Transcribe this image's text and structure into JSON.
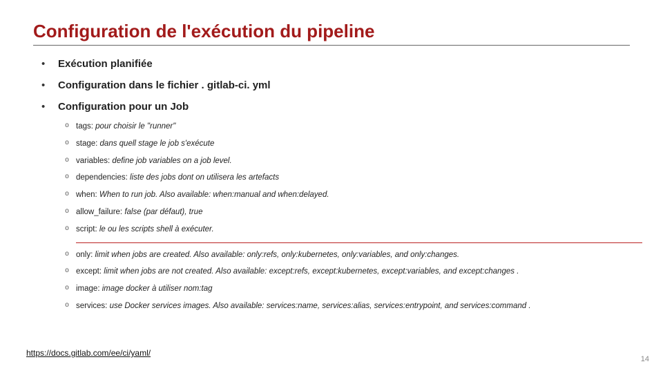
{
  "title": "Configuration de l'exécution du pipeline",
  "main_items": {
    "i0": "Exécution planifiée",
    "i1_prefix": "Configuration dans le fichier",
    "i1_file": ". gitlab-ci. yml",
    "i2": "Configuration pour un Job"
  },
  "group1": {
    "s0": {
      "key": "tags: ",
      "desc": "pour choisir le \"runner\""
    },
    "s1": {
      "key": "stage: ",
      "desc": "dans quell stage le job s'exécute"
    },
    "s2": {
      "key": "variables: ",
      "desc": "define job variables on a job level."
    },
    "s3": {
      "key": "dependencies: ",
      "desc": "liste des jobs dont on utilisera les artefacts"
    },
    "s4": {
      "key": "when: ",
      "desc": "When to run job. Also available: when:manual and when:delayed."
    },
    "s5": {
      "key": "allow_failure: ",
      "desc": "false (par défaut), true"
    },
    "s6": {
      "key": "script: ",
      "desc": "le ou les scripts shell à exécuter."
    }
  },
  "group2": {
    "s0": {
      "key": "only: ",
      "desc": "limit when jobs are created. Also available: only:refs, only:kubernetes, only:variables, and only:changes."
    },
    "s1": {
      "key": "except: ",
      "desc": "limit when jobs are not created. Also available: except:refs, except:kubernetes, except:variables, and except:changes ."
    },
    "s2": {
      "key": "image: ",
      "desc": "image docker à utiliser  nom:tag"
    },
    "s3": {
      "key": "services: ",
      "desc": "use Docker services images. Also available: services:name, services:alias, services:entrypoint, and services:command ."
    }
  },
  "footer_link": "https://docs.gitlab.com/ee/ci/yaml/",
  "page_number": "14"
}
